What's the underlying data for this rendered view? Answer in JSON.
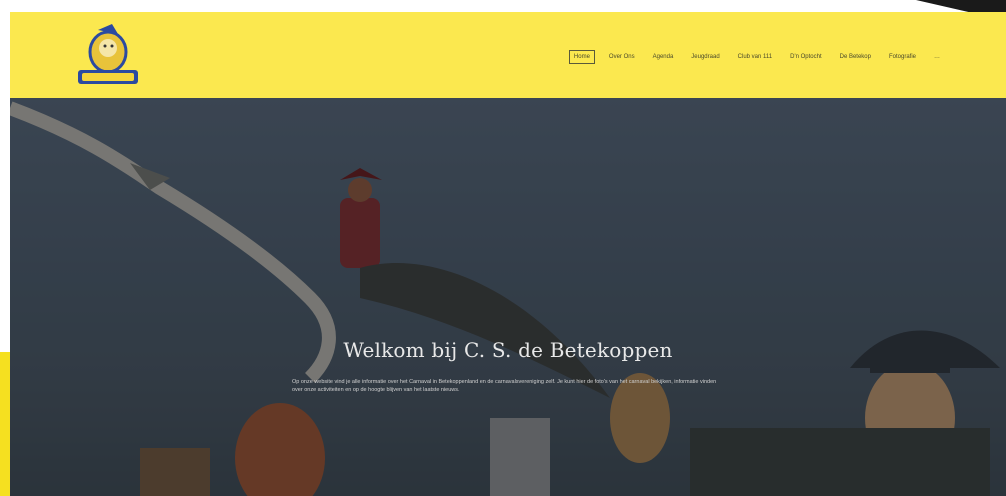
{
  "header": {
    "logo_alt": "C. S. de Betekoppen",
    "bg_color": "#fbe84f",
    "nav": [
      {
        "label": "Home",
        "active": true
      },
      {
        "label": "Over Ons",
        "active": false
      },
      {
        "label": "Agenda",
        "active": false
      },
      {
        "label": "Jeugdraad",
        "active": false
      },
      {
        "label": "Club van 111",
        "active": false
      },
      {
        "label": "D'n Optocht",
        "active": false
      },
      {
        "label": "De Betekop",
        "active": false
      },
      {
        "label": "Fotografie",
        "active": false
      },
      {
        "label": "…",
        "active": false
      }
    ]
  },
  "hero": {
    "title": "Welkom bij C. S. de Betekoppen",
    "text": "Op onze website vind je alle informatie over het Carnaval in Betekoppenland en de carnavalsvereniging zelf. Je kunt hier de foto's van het carnaval bekijken, informatie vinden over onze activiteiten en op de hoogte blijven van het laatste nieuws."
  }
}
